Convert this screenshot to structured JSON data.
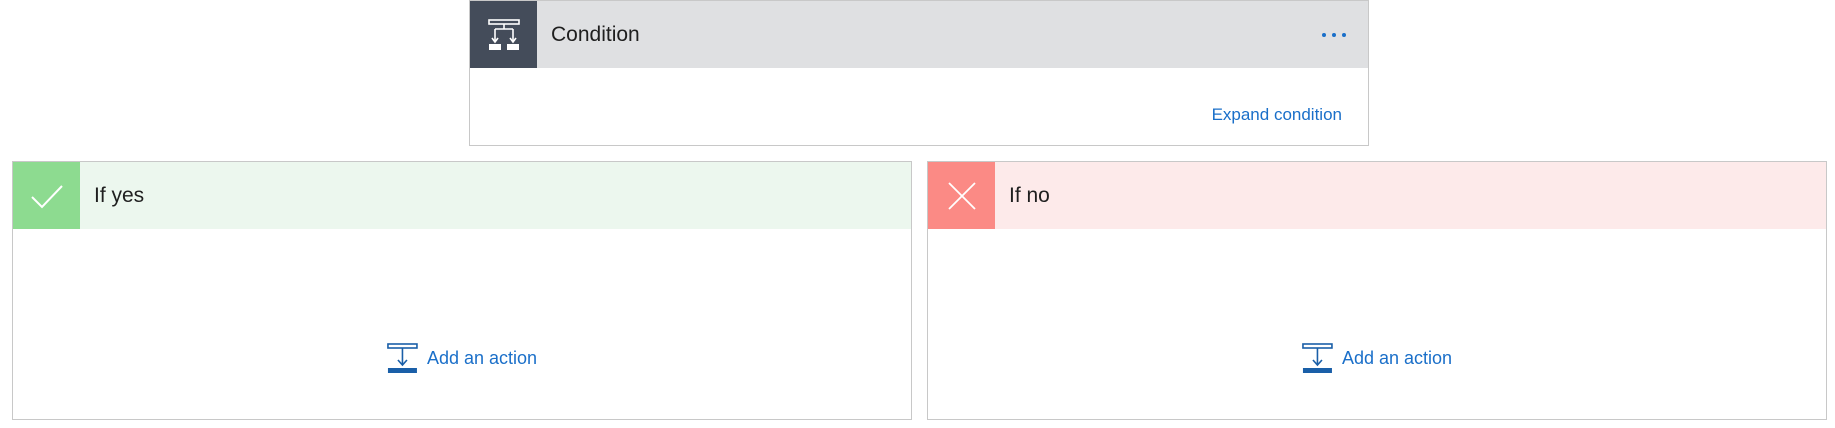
{
  "condition": {
    "title": "Condition",
    "icon": "condition-icon",
    "more_icon": "more-options-icon",
    "expand_label": "Expand condition"
  },
  "branches": {
    "yes": {
      "title": "If yes",
      "icon": "checkmark-icon",
      "add_action_label": "Add an action",
      "add_action_icon": "add-action-icon"
    },
    "no": {
      "title": "If no",
      "icon": "close-icon",
      "add_action_label": "Add an action",
      "add_action_icon": "add-action-icon"
    }
  },
  "colors": {
    "condition_header": "#dfe0e2",
    "condition_icon_bg": "#444c5a",
    "yes_header": "#ecf7ee",
    "yes_icon_bg": "#8ddb90",
    "no_header": "#fdeaea",
    "no_icon_bg": "#fb8a85",
    "link": "#1a6fc9"
  }
}
